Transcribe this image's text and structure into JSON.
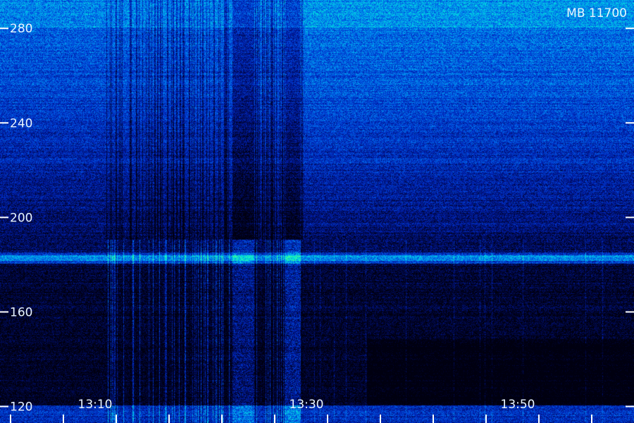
{
  "title": "MB 11700",
  "chart_data": {
    "type": "heatmap",
    "title": "MB 11700",
    "y_tick_labels": [
      "280",
      "240",
      "200",
      "160",
      "120"
    ],
    "y_ticks": [
      280,
      240,
      200,
      160,
      120
    ],
    "ylim": [
      113,
      292
    ],
    "x_tick_labels": [
      "13:10",
      "13:30",
      "13:50"
    ],
    "x_ticks_minutes": [
      790,
      810,
      830
    ],
    "xlim_minutes": [
      781,
      841
    ],
    "x_minor_step_minutes": 5,
    "colormap": [
      "#000010",
      "#000a55",
      "#0020b0",
      "#0050e0",
      "#00a0f0",
      "#00e8d8",
      "#40ff90"
    ],
    "bright_band_value": 183
  }
}
